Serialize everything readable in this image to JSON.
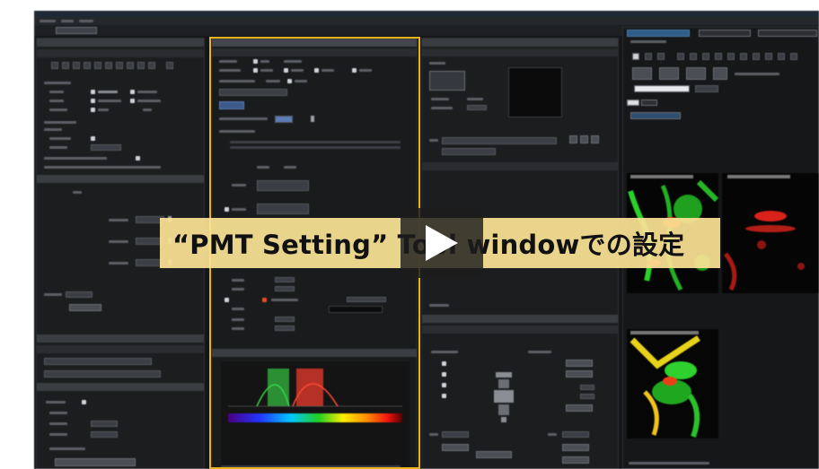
{
  "video": {
    "caption": "“PMT Setting” Tool windowでの設定",
    "play_icon": "play-triangle-icon"
  },
  "colors": {
    "highlight_border": "#e8b21a",
    "caption_background": "#fae294",
    "app_background": "#141516"
  }
}
